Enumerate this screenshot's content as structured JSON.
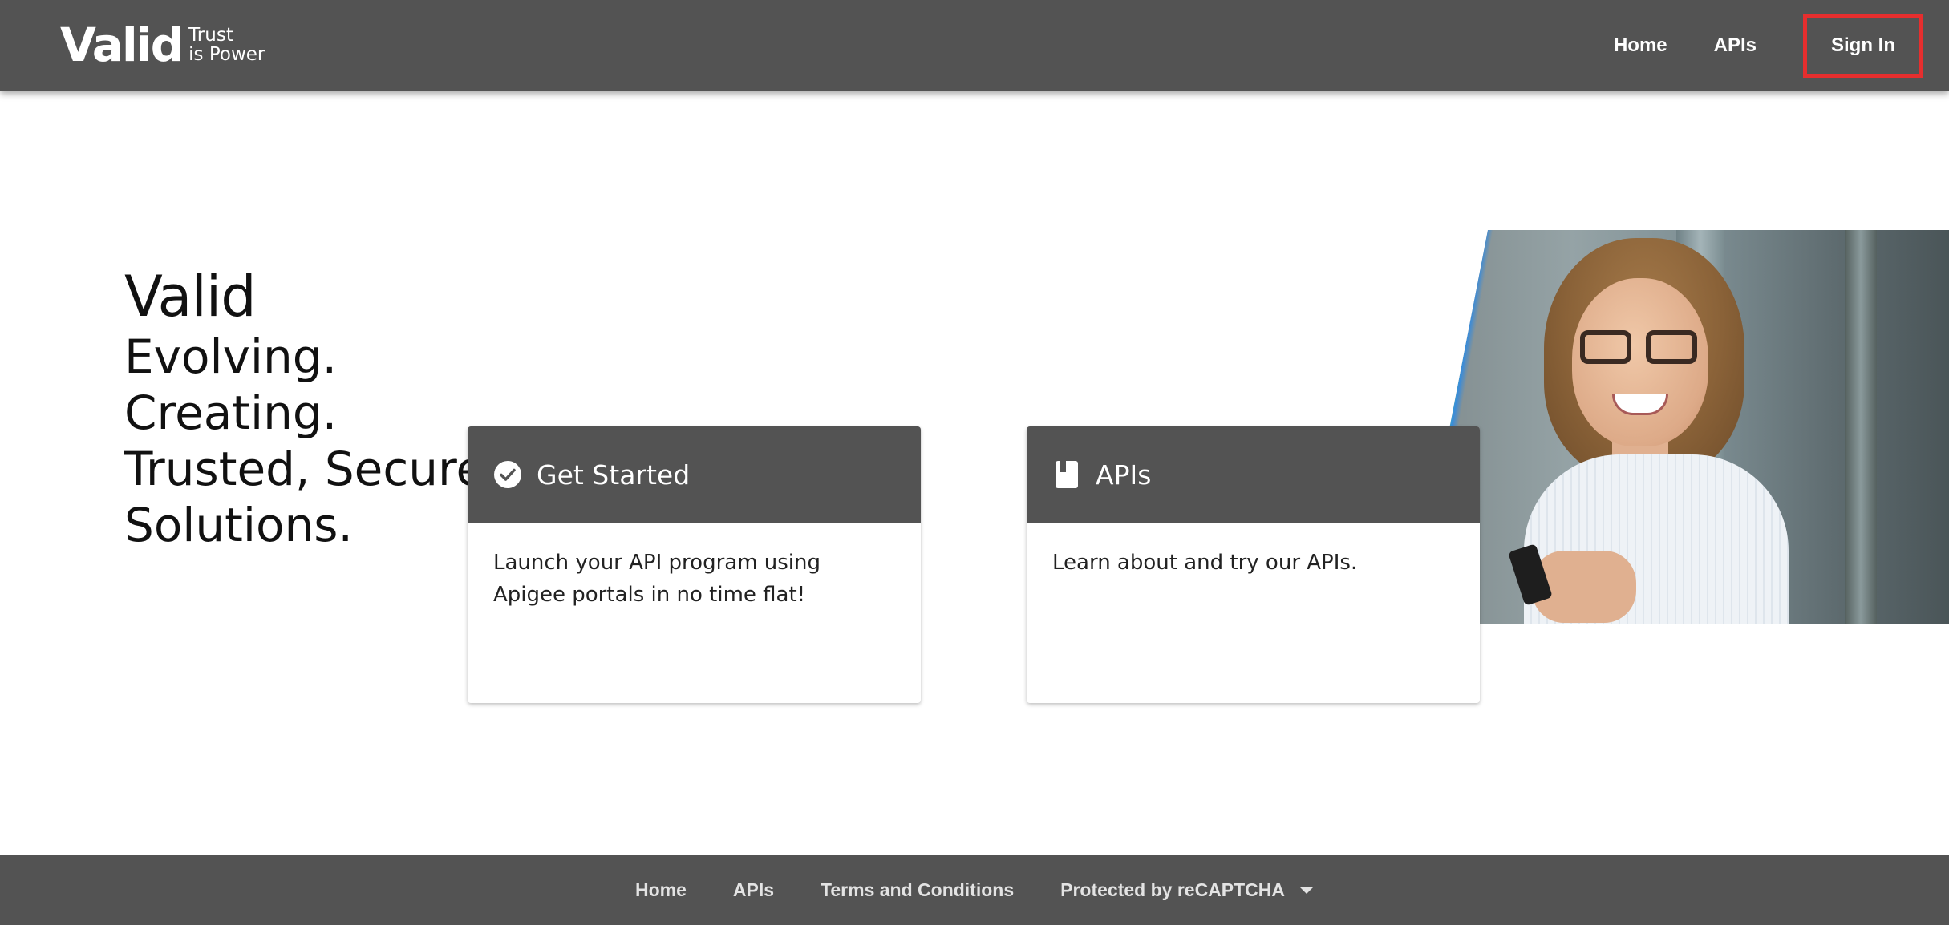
{
  "header": {
    "logo": {
      "word": "Valid",
      "tagline_1": "Trust",
      "tagline_2": "is Power"
    },
    "nav": [
      {
        "label": "Home"
      },
      {
        "label": "APIs"
      }
    ],
    "sign_in_label": "Sign In",
    "sign_in_highlight_color": "#e62e2e"
  },
  "hero": {
    "brand": "Valid",
    "lines": [
      "Evolving.",
      "Creating.",
      "Trusted, Secure",
      "Solutions."
    ]
  },
  "cards": [
    {
      "icon": "check-circle-icon",
      "title": "Get Started",
      "body": "Launch your API program using Apigee portals in no time flat!"
    },
    {
      "icon": "book-icon",
      "title": "APIs",
      "body": "Learn about and try our APIs."
    }
  ],
  "footer": {
    "links": [
      {
        "label": "Home"
      },
      {
        "label": "APIs"
      },
      {
        "label": "Terms and Conditions"
      }
    ],
    "recaptcha_label": "Protected by reCAPTCHA"
  },
  "colors": {
    "bar": "#535353",
    "text_dark": "#111111",
    "accent_stripe": "#2ad0c7"
  }
}
